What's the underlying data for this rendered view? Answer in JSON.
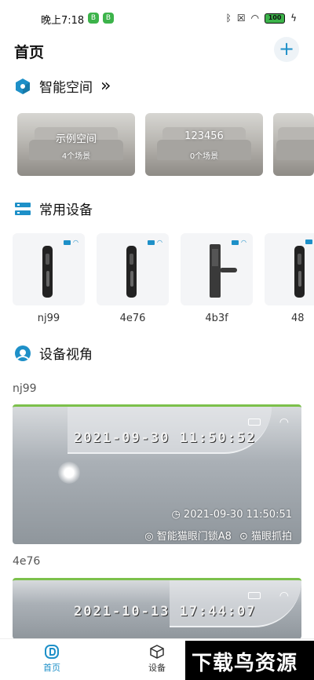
{
  "status_bar": {
    "time": "晚上7:18",
    "app_badge_1": "B",
    "app_badge_2": "B",
    "battery": "100"
  },
  "header": {
    "title": "首页",
    "add_label": "+"
  },
  "spaces": {
    "title": "智能空间",
    "more": "»",
    "items": [
      {
        "name": "示例空间",
        "count": "4个场景"
      },
      {
        "name": "123456",
        "count": "0个场景"
      }
    ]
  },
  "devices": {
    "title": "常用设备",
    "items": [
      {
        "name": "nj99",
        "icon": "smart-lock-icon"
      },
      {
        "name": "4e76",
        "icon": "smart-lock-icon"
      },
      {
        "name": "4b3f",
        "icon": "lever-lock-icon"
      },
      {
        "name": "48",
        "icon": "smart-lock-icon"
      }
    ]
  },
  "camera": {
    "title": "设备视角",
    "views": [
      {
        "device": "nj99",
        "overlay_time": "2021-09-30  11:50:52",
        "timestamp": "2021-09-30 11:50:51",
        "source": "智能猫眼门锁A8",
        "action": "猫眼抓拍"
      },
      {
        "device": "4e76",
        "overlay_time": "2021-10-13  17:44:07"
      }
    ]
  },
  "bottom_nav": {
    "items": [
      {
        "label": "首页",
        "active": true
      },
      {
        "label": "设备",
        "active": false
      }
    ]
  },
  "watermark": {
    "text": "下载鸟资源"
  },
  "colors": {
    "accent": "#1e90c8",
    "camera_border": "#7cc04b"
  }
}
